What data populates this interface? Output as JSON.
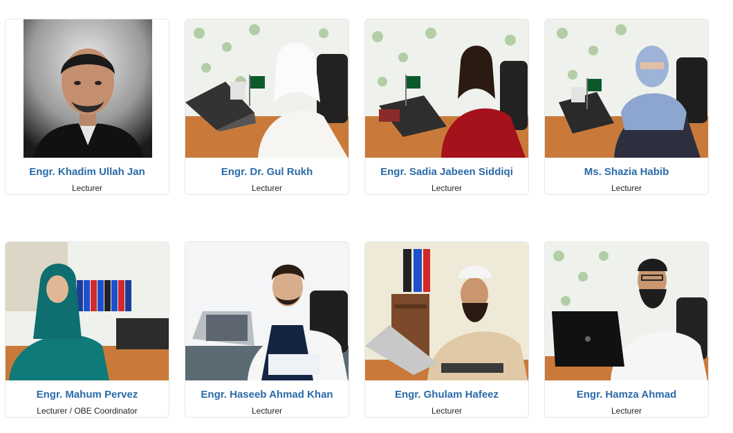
{
  "faculty": [
    {
      "name": "Engr. Khadim Ullah Jan",
      "role": "Lecturer"
    },
    {
      "name": "Engr. Dr. Gul Rukh",
      "role": "Lecturer"
    },
    {
      "name": "Engr. Sadia Jabeen Siddiqi",
      "role": "Lecturer"
    },
    {
      "name": "Ms. Shazia Habib",
      "role": "Lecturer"
    },
    {
      "name": "Engr. Mahum Pervez",
      "role": "Lecturer / OBE Coordinator"
    },
    {
      "name": "Engr. Haseeb Ahmad Khan",
      "role": "Lecturer"
    },
    {
      "name": "Engr. Ghulam Hafeez",
      "role": "Lecturer"
    },
    {
      "name": "Engr. Hamza Ahmad",
      "role": "Lecturer"
    }
  ],
  "colors": {
    "name": "#2a6aa8",
    "role": "#222222",
    "card_border": "#e6e6e6"
  }
}
